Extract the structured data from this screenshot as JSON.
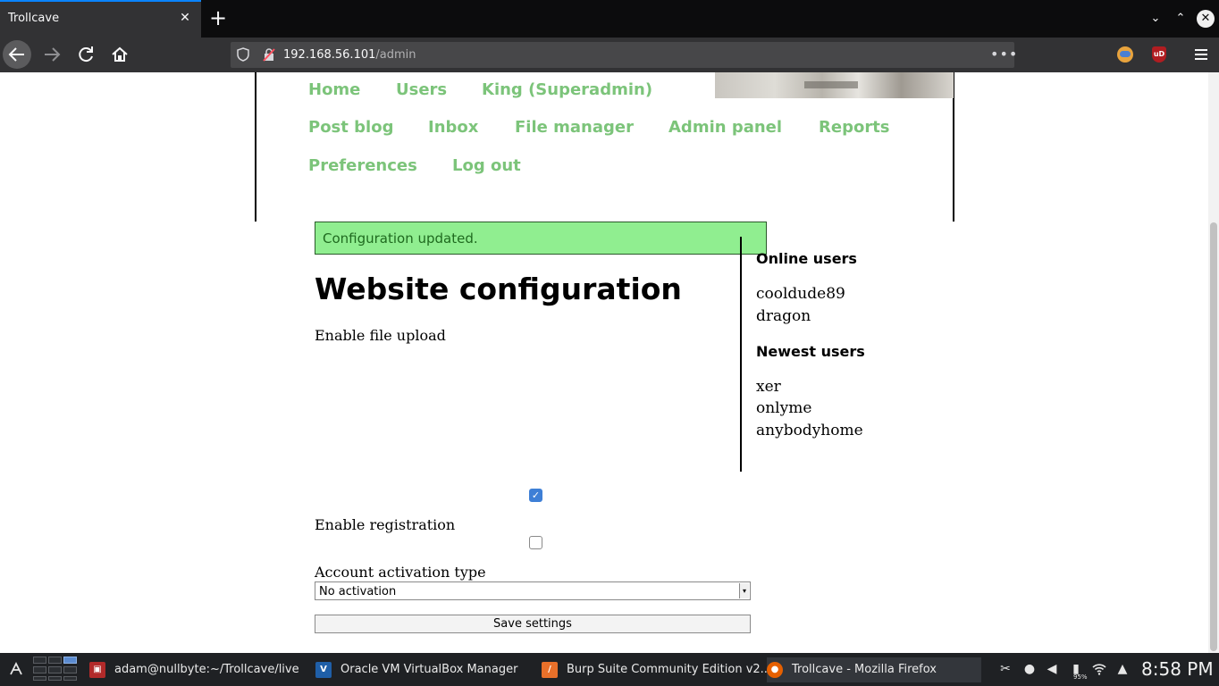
{
  "browser": {
    "tab_title": "Trollcave",
    "tab_close": "✕",
    "new_tab": "+",
    "url_host": "192.168.56.101",
    "url_path": "/admin",
    "url_more": "•••",
    "window_minimize": "⌄",
    "window_maximize": "⌃",
    "window_close": "✕",
    "accent_color": "#0a84ff"
  },
  "site": {
    "nav": [
      "Home",
      "Users",
      "King (Superadmin)",
      "Post blog",
      "Inbox",
      "File manager",
      "Admin panel",
      "Reports",
      "Preferences",
      "Log out"
    ],
    "link_color": "#7cc47a",
    "flash_message": "Configuration updated.",
    "page_title": "Website configuration",
    "form": {
      "enable_file_upload_label": "Enable file upload",
      "enable_file_upload_checked": true,
      "enable_registration_label": "Enable registration",
      "enable_registration_checked": false,
      "activation_label": "Account activation type",
      "activation_value": "No activation",
      "save_label": "Save settings"
    },
    "sidebar": {
      "online_heading": "Online users",
      "online_users": [
        "cooldude89",
        "dragon"
      ],
      "newest_heading": "Newest users",
      "newest_users": [
        "xer",
        "onlyme",
        "anybodyhome"
      ]
    }
  },
  "taskbar": {
    "tasks": [
      "adam@nullbyte:~/Trollcave/live",
      "Oracle VM VirtualBox Manager",
      "Burp Suite Community Edition v2...",
      "Trollcave - Mozilla Firefox"
    ],
    "battery": "95%",
    "clock": "8:58 PM"
  }
}
